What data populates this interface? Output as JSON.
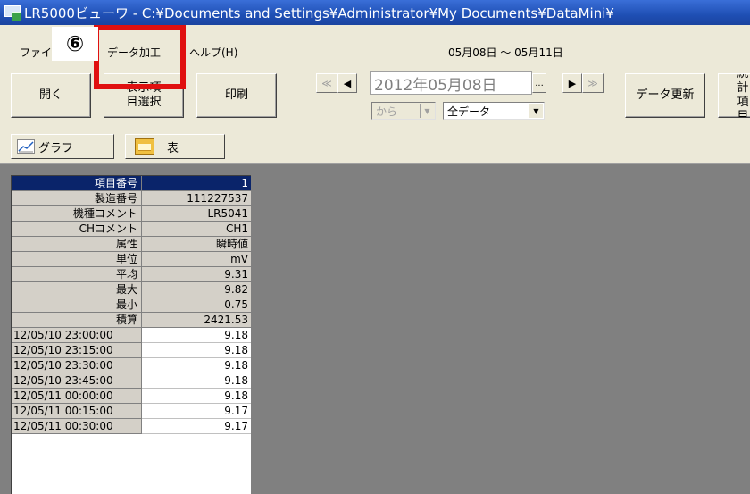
{
  "window": {
    "title": "LR5000ビューワ - C:¥Documents and Settings¥Administrator¥My Documents¥DataMini¥"
  },
  "menu": {
    "items": [
      "ファイル",
      "データ加工",
      "ヘルプ(H)"
    ],
    "date_range": "05月08日 ～ 05月11日"
  },
  "toolbar": {
    "open_label": "開く",
    "select_items_label": "表示項目選択",
    "print_label": "印刷",
    "date_value": "2012年05月08日",
    "browse_label": "...",
    "from_label": "から",
    "filter_value": "全データ",
    "update_label": "データ更新",
    "stats_label": "統計項目",
    "nav_first": "≪",
    "nav_prev": "◀",
    "nav_next": "▶",
    "nav_last": "≫"
  },
  "view_tabs": {
    "graph_label": "グラフ",
    "table_label": "表"
  },
  "annotation": {
    "step_number": "⑥",
    "highlight_color": "#e01010"
  },
  "grid": {
    "header_rows": [
      {
        "label": "項目番号",
        "value": "1"
      },
      {
        "label": "製造番号",
        "value": "111227537"
      },
      {
        "label": "機種コメント",
        "value": "LR5041"
      },
      {
        "label": "CHコメント",
        "value": "CH1"
      },
      {
        "label": "属性",
        "value": "瞬時値"
      },
      {
        "label": "単位",
        "value": "mV"
      },
      {
        "label": "平均",
        "value": "9.31"
      },
      {
        "label": "最大",
        "value": "9.82"
      },
      {
        "label": "最小",
        "value": "0.75"
      },
      {
        "label": "積算",
        "value": "2421.53"
      }
    ],
    "data_rows": [
      {
        "time": "12/05/10 23:00:00",
        "value": "9.18"
      },
      {
        "time": "12/05/10 23:15:00",
        "value": "9.18"
      },
      {
        "time": "12/05/10 23:30:00",
        "value": "9.18"
      },
      {
        "time": "12/05/10 23:45:00",
        "value": "9.18"
      },
      {
        "time": "12/05/11 00:00:00",
        "value": "9.18"
      },
      {
        "time": "12/05/11 00:15:00",
        "value": "9.17"
      },
      {
        "time": "12/05/11 00:30:00",
        "value": "9.17"
      }
    ]
  }
}
